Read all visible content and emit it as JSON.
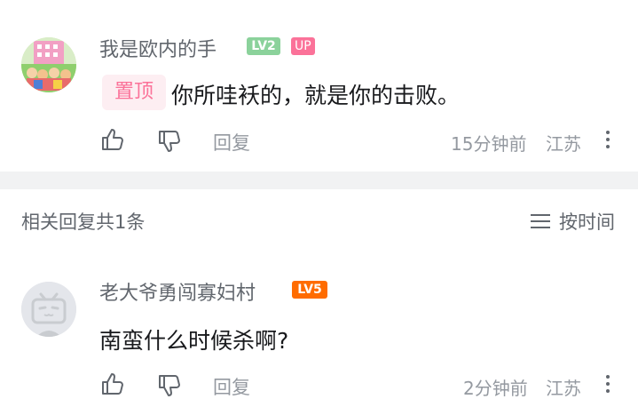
{
  "comments": [
    {
      "username": "我是欧内的手",
      "level": "LV2",
      "level_color": "#8bd29b",
      "up_badge": "UP",
      "pinned_label": "置顶",
      "text": "你所哇袄的，就是你的击败。",
      "reply_label": "回复",
      "time": "15分钟前",
      "location": "江苏"
    },
    {
      "username": "老大爷勇闯寡妇村",
      "level": "LV5",
      "level_color": "#ff6c00",
      "text": "南蛮什么时候杀啊?",
      "reply_label": "回复",
      "time": "2分钟前",
      "location": "江苏"
    }
  ],
  "section": {
    "title": "相关回复共1条",
    "sort_label": "按时间"
  },
  "icons": [
    "like-icon",
    "dislike-icon",
    "more-icon",
    "sort-icon",
    "tv-avatar-icon"
  ]
}
